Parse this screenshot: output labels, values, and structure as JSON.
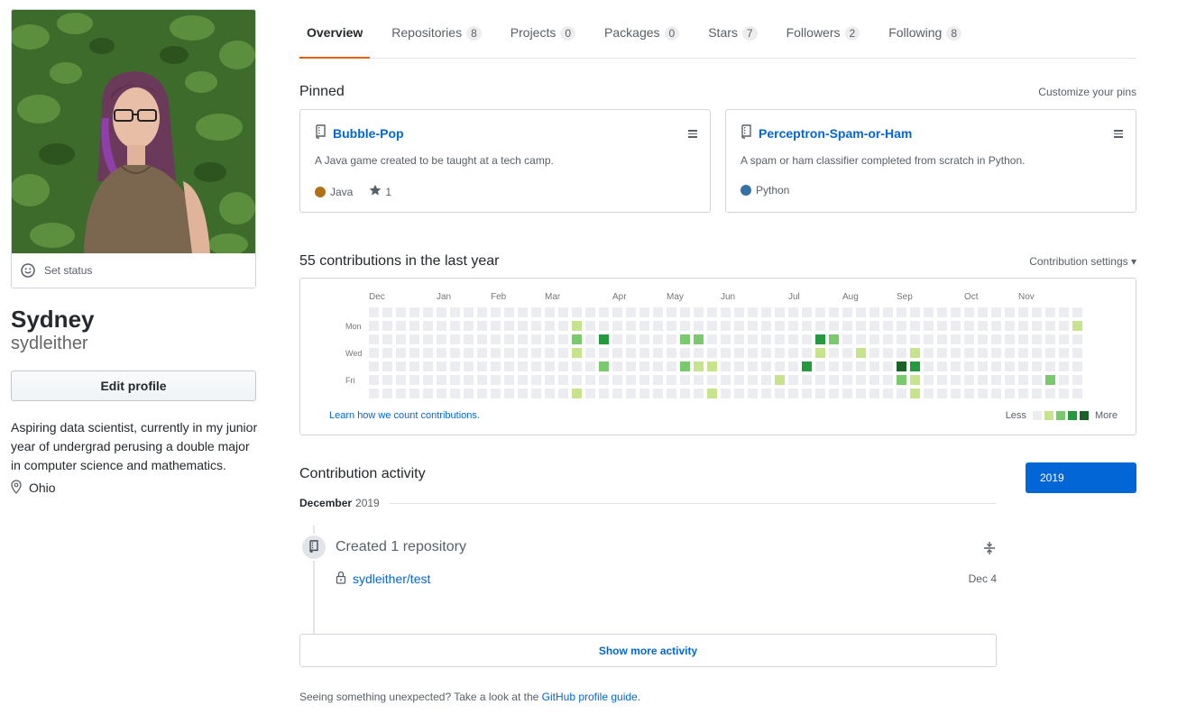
{
  "profile": {
    "set_status_label": "Set status",
    "full_name": "Sydney",
    "username": "sydleither",
    "edit_profile_label": "Edit profile",
    "bio": "Aspiring data scientist, currently in my junior year of undergrad perusing a double major in computer science and mathematics.",
    "location": "Ohio"
  },
  "tabs": [
    {
      "label": "Overview",
      "count": null,
      "selected": true
    },
    {
      "label": "Repositories",
      "count": "8"
    },
    {
      "label": "Projects",
      "count": "0"
    },
    {
      "label": "Packages",
      "count": "0"
    },
    {
      "label": "Stars",
      "count": "7"
    },
    {
      "label": "Followers",
      "count": "2"
    },
    {
      "label": "Following",
      "count": "8"
    }
  ],
  "pinned": {
    "title": "Pinned",
    "customize_label": "Customize your pins",
    "items": [
      {
        "name": "Bubble-Pop",
        "description": "A Java game created to be taught at a tech camp.",
        "language": "Java",
        "language_color": "#b07219",
        "stars": "1"
      },
      {
        "name": "Perceptron-Spam-or-Ham",
        "description": "A spam or ham classifier completed from scratch in Python.",
        "language": "Python",
        "language_color": "#3572A5",
        "stars": null
      }
    ]
  },
  "contributions": {
    "title": "55 contributions in the last year",
    "settings_label": "Contribution settings",
    "months": [
      "Dec",
      "Jan",
      "Feb",
      "Mar",
      "Apr",
      "May",
      "Jun",
      "Jul",
      "Aug",
      "Sep",
      "Oct",
      "Nov"
    ],
    "day_labels": [
      "Mon",
      "Wed",
      "Fri"
    ],
    "learn_link": "Learn how we count contributions.",
    "legend_less": "Less",
    "legend_more": "More",
    "colors": [
      "#ebedf0",
      "#c6e48b",
      "#7bc96f",
      "#239a3b",
      "#196127"
    ],
    "cells": [
      [
        15,
        2,
        2
      ],
      [
        15,
        3,
        1
      ],
      [
        15,
        1,
        1
      ],
      [
        15,
        6,
        1
      ],
      [
        17,
        2,
        3
      ],
      [
        17,
        4,
        2
      ],
      [
        23,
        2,
        2
      ],
      [
        23,
        4,
        2
      ],
      [
        24,
        2,
        2
      ],
      [
        24,
        4,
        1
      ],
      [
        24,
        7,
        2
      ],
      [
        25,
        4,
        1
      ],
      [
        25,
        6,
        1
      ],
      [
        30,
        5,
        1
      ],
      [
        32,
        4,
        3
      ],
      [
        33,
        2,
        3
      ],
      [
        33,
        3,
        1
      ],
      [
        34,
        2,
        2
      ],
      [
        36,
        3,
        1
      ],
      [
        39,
        4,
        4
      ],
      [
        39,
        5,
        2
      ],
      [
        40,
        3,
        1
      ],
      [
        40,
        4,
        3
      ],
      [
        40,
        5,
        1
      ],
      [
        40,
        6,
        1
      ],
      [
        50,
        5,
        2
      ],
      [
        51,
        7,
        1
      ],
      [
        52,
        1,
        1
      ],
      [
        53,
        3,
        2
      ],
      [
        53,
        5,
        1
      ],
      [
        56,
        4,
        1
      ]
    ]
  },
  "activity": {
    "title": "Contribution activity",
    "year_button": "2019",
    "month": "December",
    "year": "2019",
    "created_label": "Created 1 repository",
    "repo_name": "sydleither/test",
    "repo_date": "Dec 4",
    "show_more_label": "Show more activity"
  },
  "footer": {
    "text": "Seeing something unexpected? Take a look at the",
    "link": "GitHub profile guide",
    "end": "."
  }
}
